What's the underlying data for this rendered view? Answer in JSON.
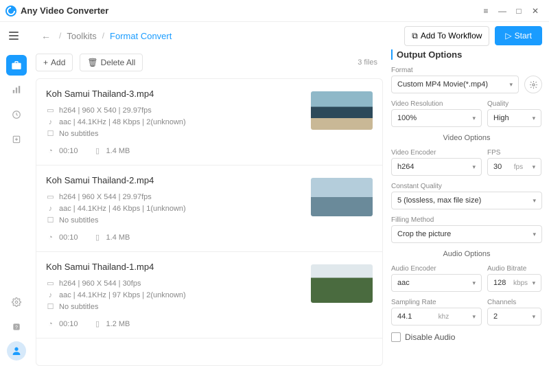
{
  "app": {
    "title": "Any Video Converter"
  },
  "breadcrumb": {
    "root": "Toolkits",
    "current": "Format Convert"
  },
  "toolbar": {
    "add_workflow": "Add To Workflow",
    "start": "Start"
  },
  "list": {
    "add": "Add",
    "delete_all": "Delete All",
    "count": "3 files",
    "files": [
      {
        "name": "Koh Samui Thailand-3.mp4",
        "video": "h264 | 960 X 540 | 29.97fps",
        "audio": "aac | 44.1KHz | 48 Kbps | 2(unknown)",
        "subs": "No subtitles",
        "duration": "00:10",
        "size": "1.4 MB"
      },
      {
        "name": "Koh Samui Thailand-2.mp4",
        "video": "h264 | 960 X 544 | 29.97fps",
        "audio": "aac | 44.1KHz | 46 Kbps | 1(unknown)",
        "subs": "No subtitles",
        "duration": "00:10",
        "size": "1.4 MB"
      },
      {
        "name": "Koh Samui Thailand-1.mp4",
        "video": "h264 | 960 X 544 | 30fps",
        "audio": "aac | 44.1KHz | 97 Kbps | 2(unknown)",
        "subs": "No subtitles",
        "duration": "00:10",
        "size": "1.2 MB"
      }
    ]
  },
  "options": {
    "title": "Output Options",
    "format_label": "Format",
    "format_value": "Custom MP4 Movie(*.mp4)",
    "resolution_label": "Video Resolution",
    "resolution_value": "100%",
    "quality_label": "Quality",
    "quality_value": "High",
    "video_section": "Video Options",
    "vencoder_label": "Video Encoder",
    "vencoder_value": "h264",
    "fps_label": "FPS",
    "fps_value": "30",
    "fps_unit": "fps",
    "cq_label": "Constant Quality",
    "cq_value": "5 (lossless, max file size)",
    "fill_label": "Filling Method",
    "fill_value": "Crop the picture",
    "audio_section": "Audio Options",
    "aencoder_label": "Audio Encoder",
    "aencoder_value": "aac",
    "abitrate_label": "Audio Bitrate",
    "abitrate_value": "128",
    "abitrate_unit": "kbps",
    "srate_label": "Sampling Rate",
    "srate_value": "44.1",
    "srate_unit": "khz",
    "channels_label": "Channels",
    "channels_value": "2",
    "disable_audio": "Disable Audio"
  }
}
